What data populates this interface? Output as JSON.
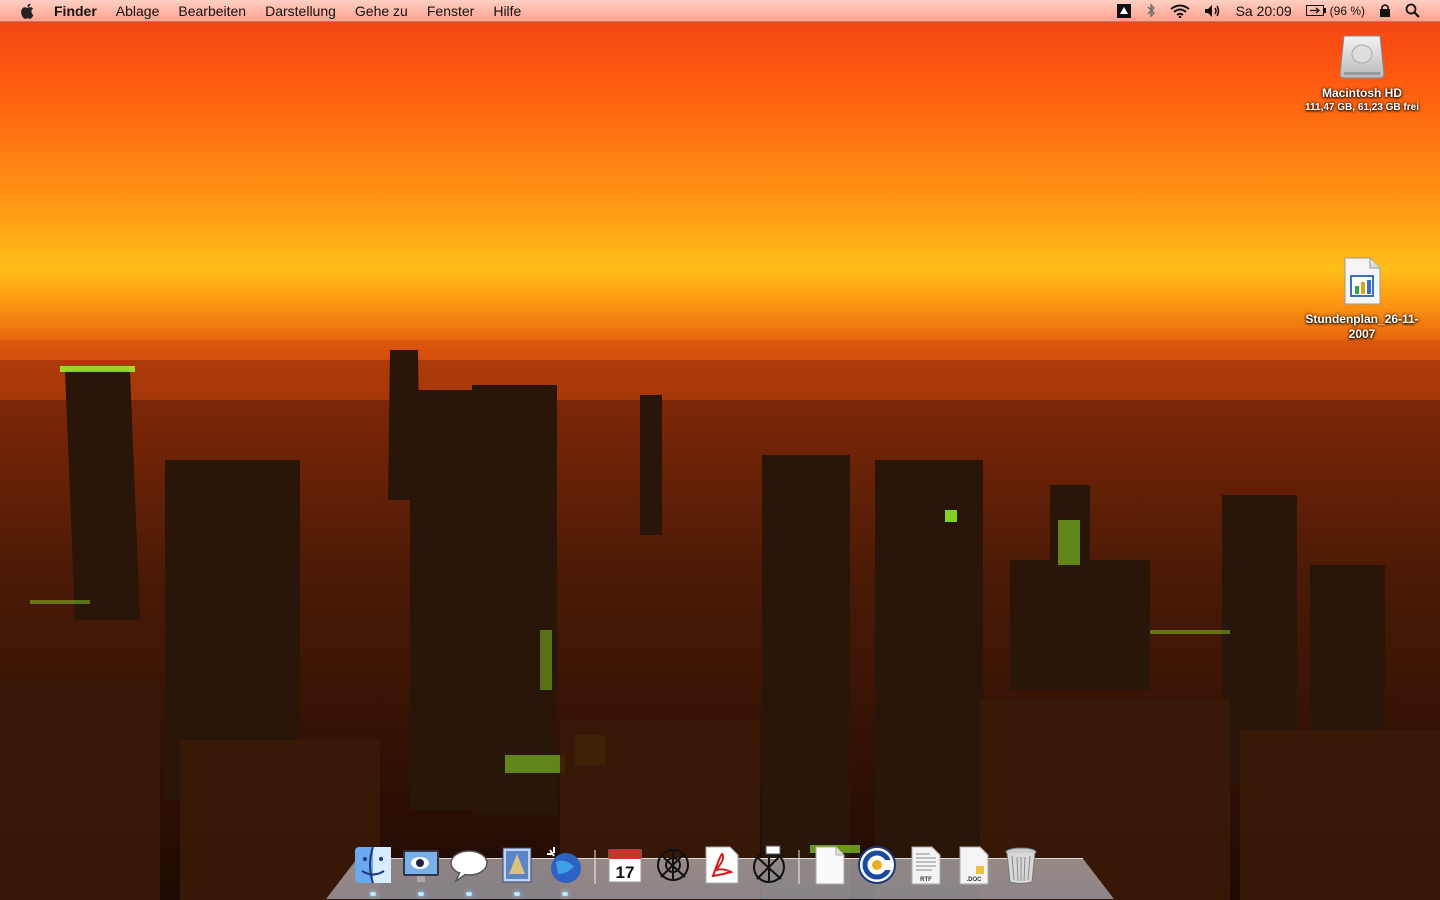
{
  "menubar": {
    "app_name": "Finder",
    "items": [
      "Ablage",
      "Bearbeiten",
      "Darstellung",
      "Gehe zu",
      "Fenster",
      "Hilfe"
    ],
    "clock": "Sa 20:09",
    "battery_percent": "(96 %)"
  },
  "desktop_icons": [
    {
      "label": "Macintosh HD",
      "sublabel": "111,47 GB, 61,23 GB frei"
    },
    {
      "label_line1": "Stundenplan_26-11-",
      "label_line2": "2007"
    }
  ],
  "dock": {
    "items": [
      "finder-icon",
      "dashboard-icon",
      "ichat-icon",
      "mail-icon",
      "browser-icon",
      "ical-icon",
      "app-icon",
      "acrobat-icon",
      "app-icon-2",
      "document-icon",
      "app-c-icon",
      "rtf-document-icon",
      "doc-document-icon",
      "trash-icon"
    ],
    "ical_day": "17",
    "rtf_label": "RTF",
    "doc_label": ".DOC"
  }
}
